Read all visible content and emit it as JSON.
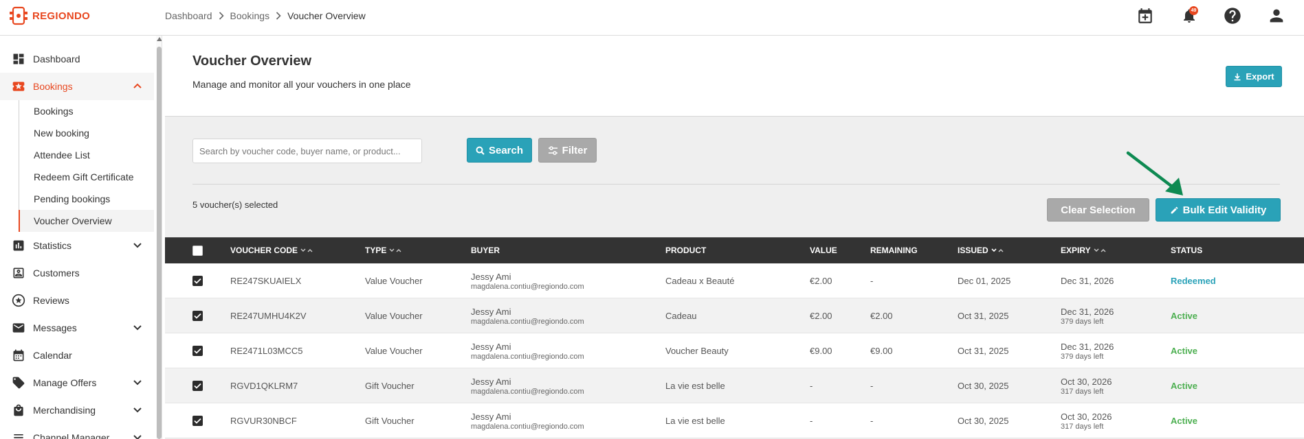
{
  "app": {
    "logo_text": "REGIONDO",
    "notification_count": "49",
    "brand_color": "#e8471f",
    "accent_color": "#2aa2b8"
  },
  "breadcrumb": [
    "Dashboard",
    "Bookings",
    "Voucher Overview"
  ],
  "sidebar": {
    "items": [
      {
        "label": "Dashboard",
        "icon": "dashboard-icon"
      },
      {
        "label": "Bookings",
        "icon": "ticket-icon",
        "expanded": true
      },
      {
        "label": "Statistics",
        "icon": "bar-chart-icon"
      },
      {
        "label": "Customers",
        "icon": "person-card-icon"
      },
      {
        "label": "Reviews",
        "icon": "star-icon"
      },
      {
        "label": "Messages",
        "icon": "mail-icon"
      },
      {
        "label": "Calendar",
        "icon": "calendar-icon"
      },
      {
        "label": "Manage Offers",
        "icon": "tag-icon"
      },
      {
        "label": "Merchandising",
        "icon": "shopping-bag-icon"
      },
      {
        "label": "Channel Manager",
        "icon": "channel-icon"
      }
    ],
    "bookings_sub": [
      "Bookings",
      "New booking",
      "Attendee List",
      "Redeem Gift Certificate",
      "Pending bookings",
      "Voucher Overview"
    ]
  },
  "page": {
    "title": "Voucher Overview",
    "subtitle": "Manage and monitor all your vouchers in one place",
    "export_label": "Export"
  },
  "toolbar": {
    "search_placeholder": "Search by voucher code, buyer name, or product...",
    "search_label": "Search",
    "filter_label": "Filter",
    "selected_text": "5 voucher(s) selected",
    "clear_label": "Clear Selection",
    "bulk_label": "Bulk Edit Validity"
  },
  "table": {
    "columns": [
      "VOUCHER CODE",
      "TYPE",
      "BUYER",
      "PRODUCT",
      "VALUE",
      "REMAINING",
      "ISSUED",
      "EXPIRY",
      "STATUS"
    ],
    "rows": [
      {
        "code": "RE247SKUAIELX",
        "type": "Value Voucher",
        "buyer": "Jessy Ami",
        "email": "magdalena.contiu@regiondo.com",
        "product": "Cadeau x Beauté",
        "value": "€2.00",
        "remaining": "-",
        "issued": "Dec 01, 2025",
        "expiry": "Dec 31, 2026",
        "expiry_note": "",
        "status": "Redeemed",
        "status_color": "#2aa2b8"
      },
      {
        "code": "RE247UMHU4K2V",
        "type": "Value Voucher",
        "buyer": "Jessy Ami",
        "email": "magdalena.contiu@regiondo.com",
        "product": "Cadeau",
        "value": "€2.00",
        "remaining": "€2.00",
        "issued": "Oct 31, 2025",
        "expiry": "Dec 31, 2026",
        "expiry_note": "379 days left",
        "status": "Active",
        "status_color": "#4caf50"
      },
      {
        "code": "RE2471L03MCC5",
        "type": "Value Voucher",
        "buyer": "Jessy Ami",
        "email": "magdalena.contiu@regiondo.com",
        "product": "Voucher Beauty",
        "value": "€9.00",
        "remaining": "€9.00",
        "issued": "Oct 31, 2025",
        "expiry": "Dec 31, 2026",
        "expiry_note": "379 days left",
        "status": "Active",
        "status_color": "#4caf50"
      },
      {
        "code": "RGVD1QKLRM7",
        "type": "Gift Voucher",
        "buyer": "Jessy Ami",
        "email": "magdalena.contiu@regiondo.com",
        "product": "La vie est belle",
        "value": "-",
        "remaining": "-",
        "issued": "Oct 30, 2025",
        "expiry": "Oct 30, 2026",
        "expiry_note": "317 days left",
        "status": "Active",
        "status_color": "#4caf50"
      },
      {
        "code": "RGVUR30NBCF",
        "type": "Gift Voucher",
        "buyer": "Jessy Ami",
        "email": "magdalena.contiu@regiondo.com",
        "product": "La vie est belle",
        "value": "-",
        "remaining": "-",
        "issued": "Oct 30, 2025",
        "expiry": "Oct 30, 2026",
        "expiry_note": "317 days left",
        "status": "Active",
        "status_color": "#4caf50"
      }
    ]
  }
}
